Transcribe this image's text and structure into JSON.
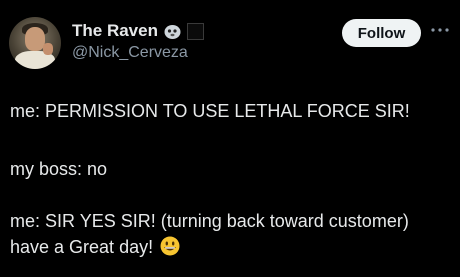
{
  "author": {
    "display_name": "The Raven",
    "handle": "@Nick_Cerveza",
    "badges": [
      "ghost-emoji-icon",
      "black-square-icon"
    ]
  },
  "actions": {
    "follow_label": "Follow",
    "more_icon": "more-options-icon"
  },
  "tweet": {
    "line1": "me: PERMISSION TO USE LETHAL FORCE SIR!",
    "line2": "my boss: no",
    "line3": "me: SIR YES SIR! (turning back toward customer)",
    "line4": "have a Great day!",
    "emoji": "grinning-face-icon"
  },
  "colors": {
    "background": "#000000",
    "text": "#e7e9ea",
    "secondary_text": "#8b98a5",
    "follow_button": "#eff3f4"
  }
}
